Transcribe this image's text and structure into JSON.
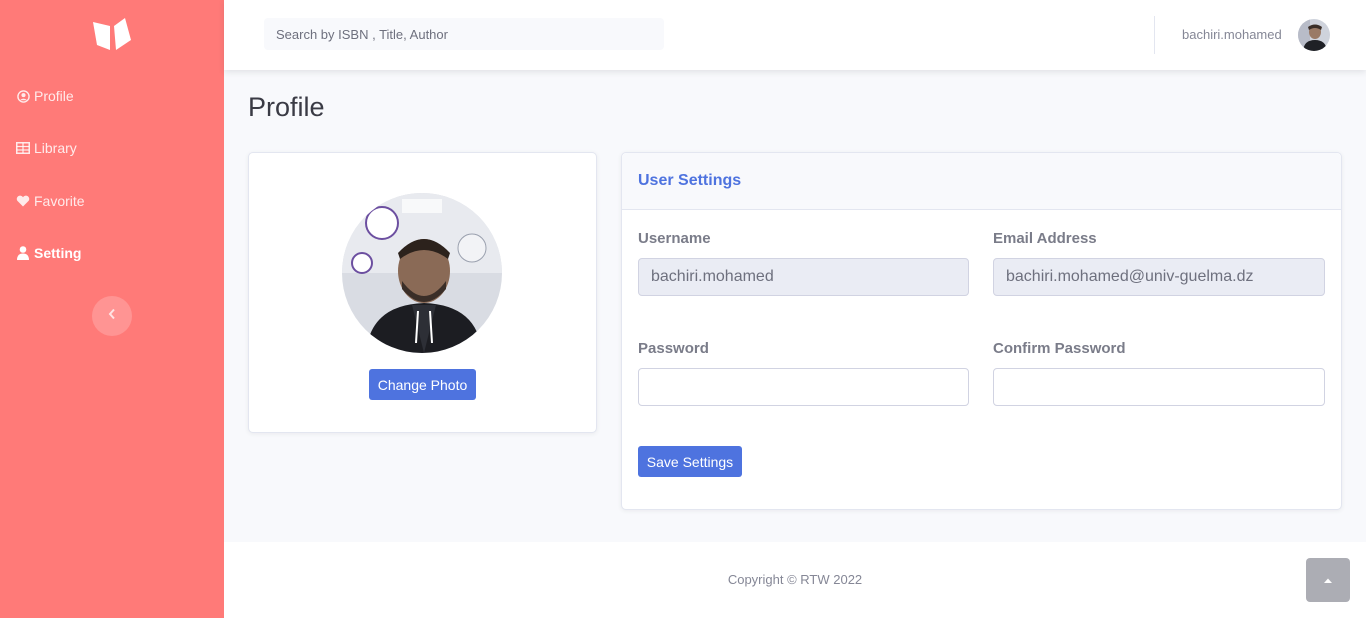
{
  "sidebar": {
    "brand_icon": "open-book-icon",
    "items": [
      {
        "label": "Profile",
        "icon": "user-circle-icon"
      },
      {
        "label": "Library",
        "icon": "table-icon"
      },
      {
        "label": "Favorite",
        "icon": "heart-icon"
      },
      {
        "label": "Setting",
        "icon": "user-icon"
      }
    ],
    "toggle_icon": "chevron-left-icon"
  },
  "topbar": {
    "search_placeholder": "Search by ISBN , Title, Author",
    "username": "bachiri.mohamed"
  },
  "page": {
    "title": "Profile"
  },
  "photo_card": {
    "change_photo_label": "Change Photo"
  },
  "settings": {
    "header": "User Settings",
    "username_label": "Username",
    "username_value": "bachiri.mohamed",
    "email_label": "Email Address",
    "email_value": "bachiri.mohamed@univ-guelma.dz",
    "password_label": "Password",
    "password_value": "",
    "confirm_label": "Confirm Password",
    "confirm_value": "",
    "save_label": "Save Settings"
  },
  "footer": {
    "copyright": "Copyright © RTW 2022"
  },
  "colors": {
    "sidebar": "#ff7a78",
    "primary": "#4e73df",
    "background": "#f8f9fc"
  }
}
